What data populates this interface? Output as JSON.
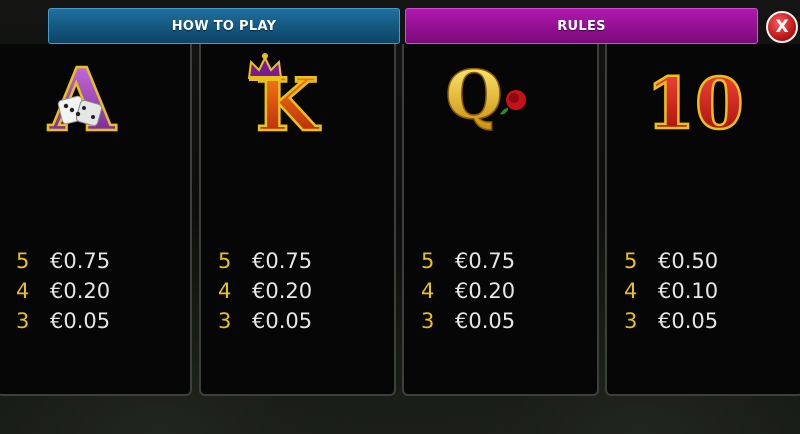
{
  "tabs": {
    "how_to_play": "HOW TO PLAY",
    "rules": "RULES"
  },
  "close_label": "X",
  "panels": [
    {
      "symbol": "A",
      "icon": "dice-icon",
      "rows": [
        {
          "count": "5",
          "amount": "€0.75"
        },
        {
          "count": "4",
          "amount": "€0.20"
        },
        {
          "count": "3",
          "amount": "€0.05"
        }
      ]
    },
    {
      "symbol": "K",
      "icon": "crown-icon",
      "rows": [
        {
          "count": "5",
          "amount": "€0.75"
        },
        {
          "count": "4",
          "amount": "€0.20"
        },
        {
          "count": "3",
          "amount": "€0.05"
        }
      ]
    },
    {
      "symbol": "Q",
      "icon": "rose-icon",
      "rows": [
        {
          "count": "5",
          "amount": "€0.75"
        },
        {
          "count": "4",
          "amount": "€0.20"
        },
        {
          "count": "3",
          "amount": "€0.05"
        }
      ]
    },
    {
      "symbol": "10",
      "icon": "",
      "rows": [
        {
          "count": "5",
          "amount": "€0.50"
        },
        {
          "count": "4",
          "amount": "€0.10"
        },
        {
          "count": "3",
          "amount": "€0.05"
        }
      ]
    }
  ],
  "colors": {
    "how_to_play_tab": "#1f6f9e",
    "rules_tab": "#b018b0",
    "count": "#e8c21a",
    "amount": "#e6e6e6",
    "close": "#d02020"
  }
}
